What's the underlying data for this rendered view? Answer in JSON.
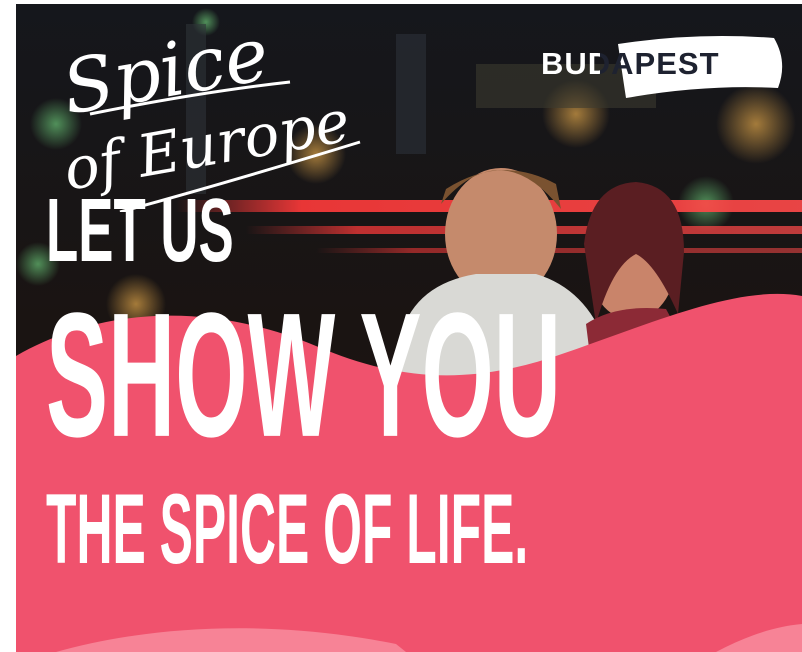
{
  "ad": {
    "tagline": {
      "line1": "Spice",
      "line2": "of Europe"
    },
    "brand": "BUDAPEST",
    "headline": {
      "line1": "LET US",
      "line2": "SHOW YOU",
      "line3": "THE SPICE OF LIFE."
    }
  },
  "colors": {
    "accent_pink": "#f0526d",
    "light_pink": "#f78396",
    "text": "#ffffff",
    "background_dark": "#0d0d0f"
  }
}
